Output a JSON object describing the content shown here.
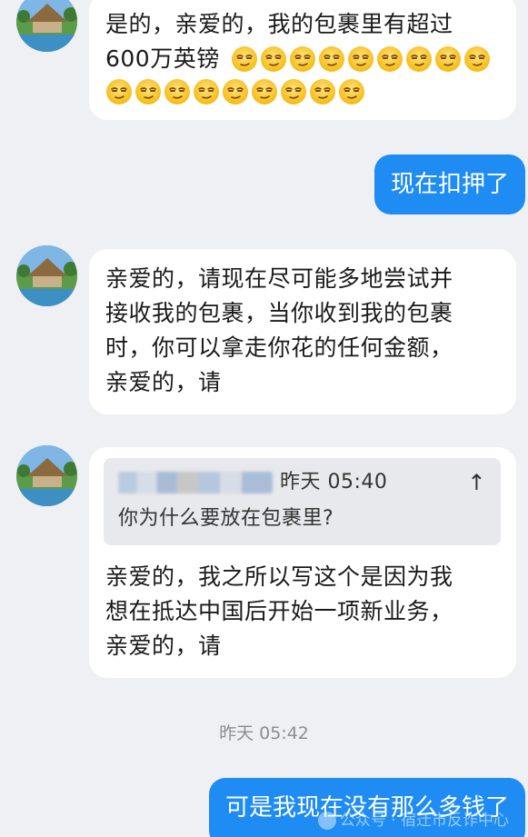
{
  "messages": [
    {
      "side": "in",
      "lines": [
        "是的，亲爱的，我的包裹里有超过",
        "600万英镑"
      ],
      "emoji_name": "smirking-face-emoji",
      "emoji_count_line1": 9,
      "emoji_count_line2": 9
    },
    {
      "side": "out",
      "text": "现在扣押了"
    },
    {
      "side": "in",
      "lines": [
        "亲爱的，请现在尽可能多地尝试并",
        "接收我的包裹，当你收到我的包裹",
        "时，你可以拿走你花的任何金额，",
        "亲爱的，请"
      ]
    },
    {
      "side": "in",
      "quote": {
        "time": "昨天 05:40",
        "arrow": "↑",
        "text": "你为什么要放在包裹里?"
      },
      "lines": [
        "亲爱的，我之所以写这个是因为我",
        "想在抵达中国后开始一项新业务，",
        "亲爱的，请"
      ]
    },
    {
      "side": "out",
      "text": "可是我现在没有那么多钱了"
    }
  ],
  "timestamp": "昨天 05:42",
  "watermark": "公众号 · 宿迁市反诈中心",
  "colors": {
    "background": "#eef0f4",
    "incoming_bubble": "#ffffff",
    "outgoing_bubble": "#1e8cf2",
    "quote_background": "#e8e9ec",
    "timestamp_text": "#8a8d93"
  }
}
